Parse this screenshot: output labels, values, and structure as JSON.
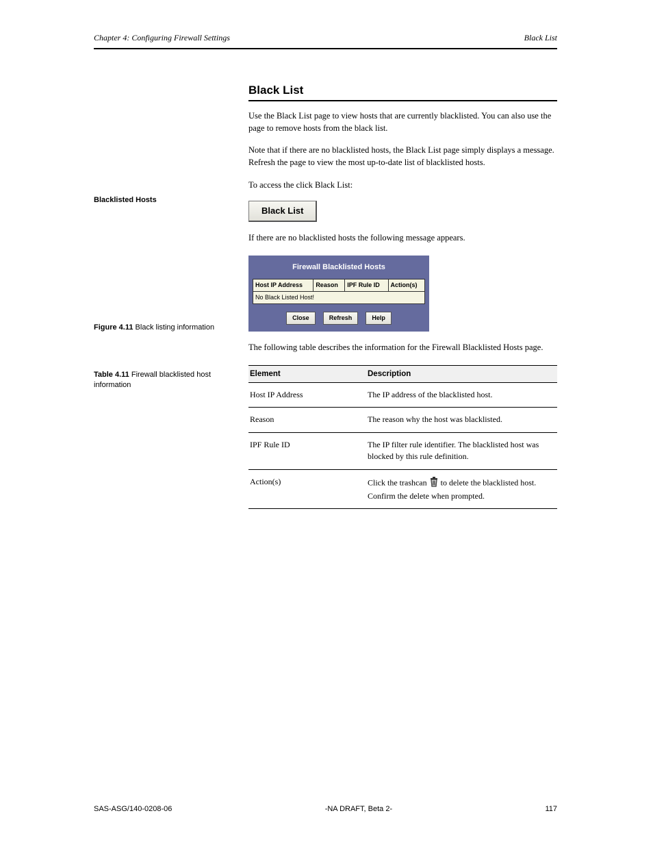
{
  "header": {
    "left": "Chapter 4: Configuring Firewall Settings",
    "right": "Black List"
  },
  "section": {
    "heading": "Black List",
    "intro_p1": "Use the Black List page to view hosts that are currently blacklisted. You can also use the page to remove hosts from the black list.",
    "intro_p2": "Note that if there are no blacklisted hosts, the Black List page simply displays a message. Refresh the page to view the most up-to-date list of blacklisted hosts.",
    "access_instruction": "To access the click Black List:",
    "black_list_button": "Black List",
    "result_intro": "If there are no blacklisted hosts the following message appears."
  },
  "sidebar": {
    "label_blacklisted_hosts": "Blacklisted Hosts"
  },
  "panel": {
    "title": "Firewall Blacklisted Hosts",
    "columns": [
      "Host IP Address",
      "Reason",
      "IPF Rule ID",
      "Action(s)"
    ],
    "empty_row": "No Black Listed Host!",
    "buttons": {
      "close": "Close",
      "refresh": "Refresh",
      "help": "Help"
    }
  },
  "figure": {
    "num": "Figure 4.11",
    "caption": "Black listing information"
  },
  "elements_intro": "The following table describes the information for the Firewall Blacklisted Hosts page.",
  "elements_table": {
    "head": [
      "Element",
      "Description"
    ],
    "rows": [
      {
        "element": "Host IP Address",
        "description": "The IP address of the blacklisted host."
      },
      {
        "element": "Reason",
        "description": "The reason why the host was blacklisted."
      },
      {
        "element": "IPF Rule ID",
        "description": "The IP filter rule identifier. The blacklisted host was blocked by this rule definition."
      },
      {
        "element": "Action(s)",
        "description_prefix": "Click the trashcan ",
        "description_suffix": " to delete the blacklisted host. Confirm the delete when prompted."
      }
    ]
  },
  "table_caption": {
    "num": "Table 4.11",
    "caption": "Firewall blacklisted host information"
  },
  "footer": {
    "left": "SAS-ASG/140-0208-06",
    "middle": "-NA DRAFT, Beta 2-",
    "right": "117"
  }
}
